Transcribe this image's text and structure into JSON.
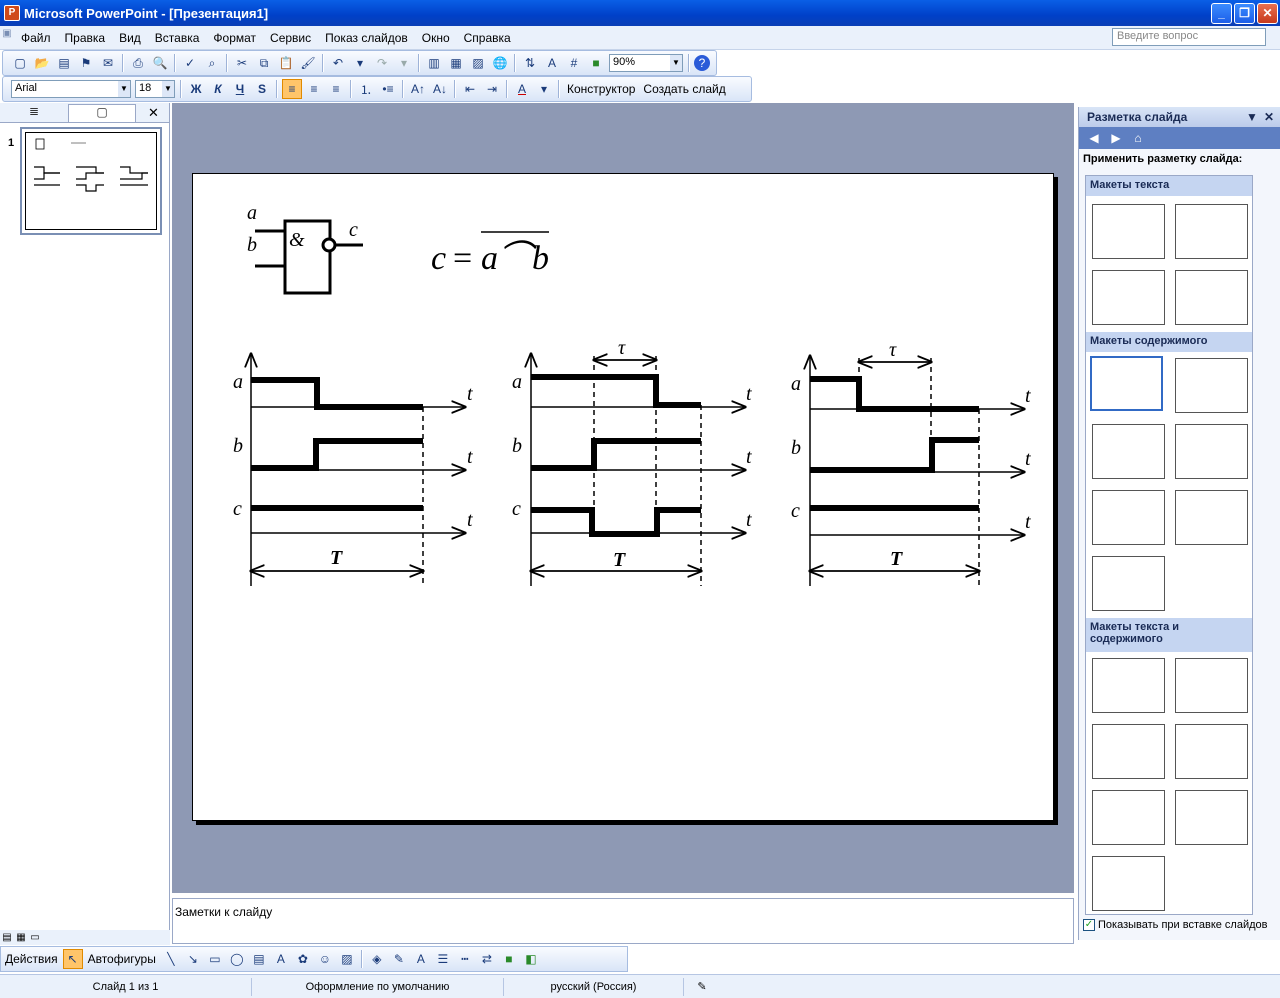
{
  "window": {
    "title": "Microsoft PowerPoint - [Презентация1]",
    "app_icon": "powerpoint-icon"
  },
  "menu": {
    "items": [
      "Файл",
      "Правка",
      "Вид",
      "Вставка",
      "Формат",
      "Сервис",
      "Показ слайдов",
      "Окно",
      "Справка"
    ],
    "help_placeholder": "Введите вопрос"
  },
  "standard_toolbar": {
    "zoom": "90%"
  },
  "format_toolbar": {
    "font": "Arial",
    "size": "18",
    "bold": "Ж",
    "italic": "К",
    "underline": "Ч",
    "shadow": "S",
    "designer": "Конструктор",
    "new_slide": "Создать слайд"
  },
  "slides_pane": {
    "slide_number": "1"
  },
  "slide": {
    "gate_inputs": [
      "a",
      "b"
    ],
    "gate_output": "c",
    "gate_symbol": "&",
    "formula_lhs": "c",
    "formula_eq": "=",
    "formula_rhs": "a⌒b",
    "diagrams": [
      {
        "signals": [
          "a",
          "b",
          "c"
        ],
        "time_label": "t",
        "period_label": "T",
        "delay_label": ""
      },
      {
        "signals": [
          "a",
          "b",
          "c"
        ],
        "time_label": "t",
        "period_label": "T",
        "delay_label": "τ"
      },
      {
        "signals": [
          "a",
          "b",
          "c"
        ],
        "time_label": "t",
        "period_label": "T",
        "delay_label": "τ"
      }
    ]
  },
  "notes": {
    "placeholder": "Заметки к слайду"
  },
  "task_pane": {
    "title": "Разметка слайда",
    "apply_label": "Применить разметку слайда:",
    "section_text": "Макеты текста",
    "section_content": "Макеты содержимого",
    "section_text_content": "Макеты текста и содержимого",
    "show_on_insert": "Показывать при вставке слайдов"
  },
  "drawing_toolbar": {
    "actions": "Действия",
    "autoshapes": "Автофигуры"
  },
  "status": {
    "slide_of": "Слайд 1 из 1",
    "design": "Оформление по умолчанию",
    "language": "русский (Россия)"
  },
  "colors": {
    "title_bar": "#0040c8",
    "workspace": "#8e99b4",
    "task_nav": "#5e7fc2"
  }
}
